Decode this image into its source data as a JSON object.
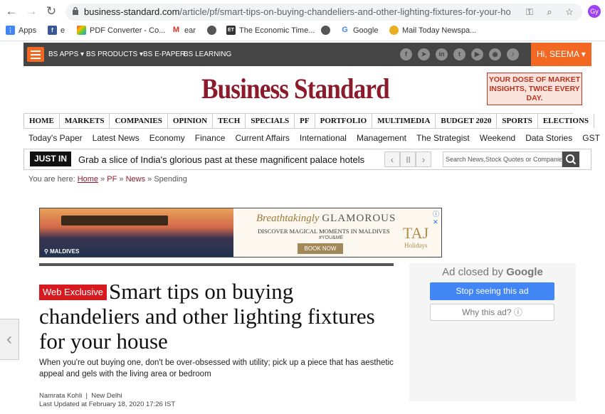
{
  "browser": {
    "url_host": "business-standard.com",
    "url_path": "/article/pf/smart-tips-on-buying-chandeliers-and-other-lighting-fixtures-for-your-house...",
    "profile_initials": "Gy",
    "bookmarks": [
      {
        "label": "Apps",
        "icon": "apps-grid-icon"
      },
      {
        "label": "e",
        "icon": "facebook-icon"
      },
      {
        "label": "PDF Converter - Co...",
        "icon": "pdf-icon"
      },
      {
        "label": "ear",
        "icon": "gmail-icon"
      },
      {
        "label": "",
        "icon": "globe-icon"
      },
      {
        "label": "The Economic Time...",
        "icon": "et-icon"
      },
      {
        "label": "",
        "icon": "globe-icon"
      },
      {
        "label": "Google",
        "icon": "google-icon"
      },
      {
        "label": "Mail Today Newspa...",
        "icon": "mail-today-icon"
      }
    ]
  },
  "topbar": {
    "links": [
      "BS APPS",
      "BS PRODUCTS",
      "BS E-PAPER",
      "BS LEARNING"
    ],
    "greeting": "Hi, SEEMA"
  },
  "masthead": {
    "logo": "Business Standard",
    "promo": "YOUR DOSE OF MARKET INSIGHTS, TWICE EVERY DAY."
  },
  "main_nav": [
    "HOME",
    "MARKETS",
    "COMPANIES",
    "OPINION",
    "TECH",
    "SPECIALS",
    "PF",
    "PORTFOLIO",
    "MULTIMEDIA",
    "BUDGET 2020",
    "SPORTS",
    "ELECTIONS"
  ],
  "sub_nav": [
    "Today's Paper",
    "Latest News",
    "Economy",
    "Finance",
    "Current Affairs",
    "International",
    "Management",
    "The Strategist",
    "Weekend",
    "Data Stories",
    "GST"
  ],
  "just_in": {
    "tag": "JUST IN",
    "headline": "Grab a slice of India's glorious past at these magnificent palace hotels",
    "search_placeholder": "Search News,Stock Quotes or Companies"
  },
  "breadcrumb": {
    "prefix": "You are here:",
    "items": [
      "Home",
      "PF",
      "News",
      "Spending"
    ]
  },
  "ad_banner": {
    "location": "MALDIVES",
    "tagline_script": "Breathtakingly",
    "tagline_caps": "GLAMOROUS",
    "subline": "DISCOVER MAGICAL MOMENTS IN MALDIVES",
    "hashtag": "#YOU&ME",
    "cta": "BOOK NOW",
    "brand": "TAJ",
    "brand_sub": "Holidays"
  },
  "article": {
    "badge": "Web Exclusive",
    "headline": "Smart tips on buying chandeliers and other lighting fixtures for your house",
    "summary": "When you're out buying one, don't be over-obsessed with utility; pick up a piece that has aesthetic appeal and gels with the living area or bedroom",
    "author": "Namrata Kohli",
    "location": "New Delhi",
    "updated": "Last Updated at February 18, 2020 17:26 IST"
  },
  "ad_closed": {
    "title_prefix": "Ad closed by",
    "title_brand": "Google",
    "stop_button": "Stop seeing this ad",
    "why_button": "Why this ad? ⓘ"
  }
}
